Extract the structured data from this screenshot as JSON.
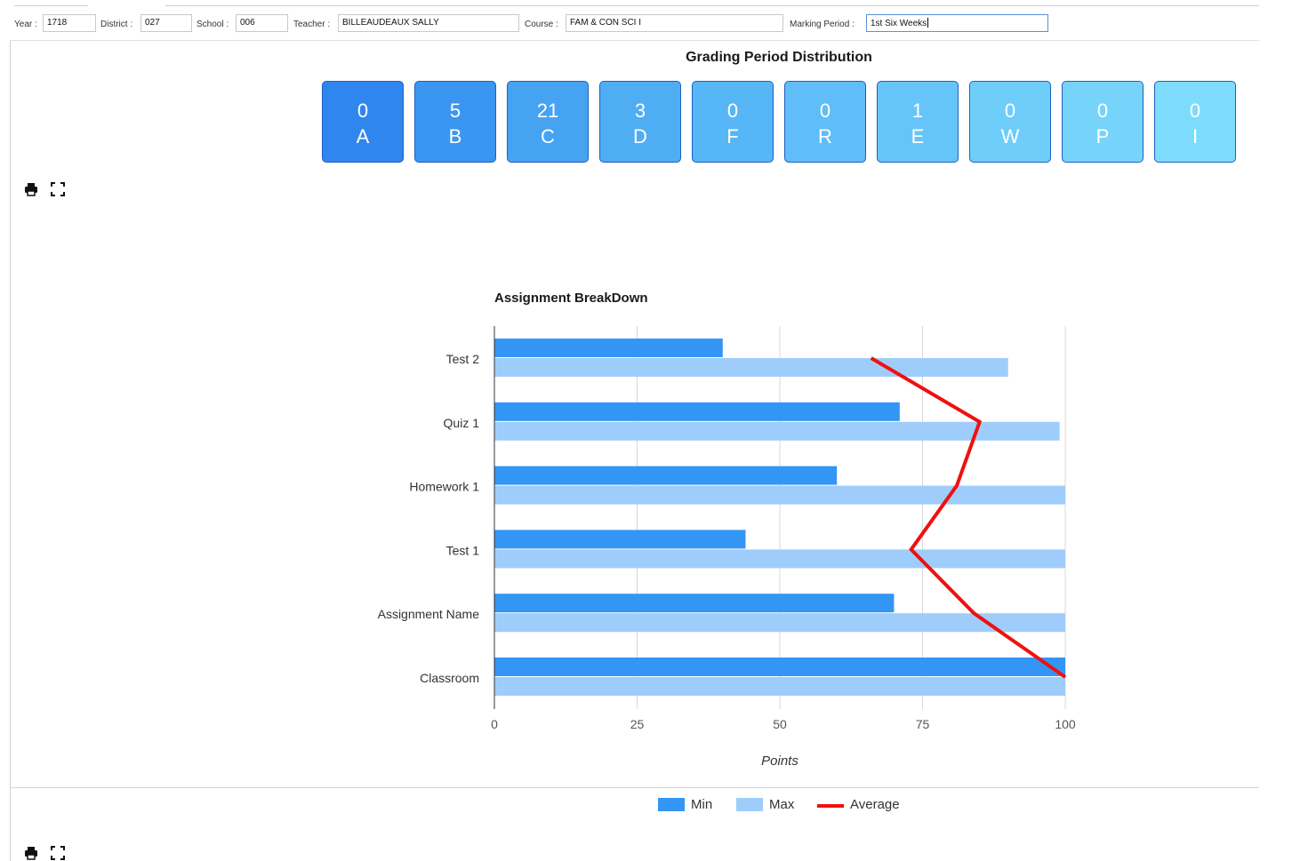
{
  "filters": {
    "year_label": "Year :",
    "year_value": "1718",
    "district_label": "District :",
    "district_value": "027",
    "school_label": "School :",
    "school_value": "006",
    "teacher_label": "Teacher :",
    "teacher_value": "BILLEAUDEAUX SALLY",
    "course_label": "Course :",
    "course_value": "FAM & CON SCI I",
    "marking_label": "Marking Period :",
    "marking_value": "1st Six Weeks"
  },
  "distribution": {
    "title": "Grading Period Distribution",
    "tiles": [
      {
        "count": "0",
        "grade": "A",
        "color": "#2f86ee"
      },
      {
        "count": "5",
        "grade": "B",
        "color": "#3a96f1"
      },
      {
        "count": "21",
        "grade": "C",
        "color": "#45a3f2"
      },
      {
        "count": "3",
        "grade": "D",
        "color": "#4fadf4"
      },
      {
        "count": "0",
        "grade": "F",
        "color": "#56b6f6"
      },
      {
        "count": "0",
        "grade": "R",
        "color": "#5fbdf7"
      },
      {
        "count": "1",
        "grade": "E",
        "color": "#66c5f8"
      },
      {
        "count": "0",
        "grade": "W",
        "color": "#6ecdf9"
      },
      {
        "count": "0",
        "grade": "P",
        "color": "#76d4fb"
      },
      {
        "count": "0",
        "grade": "I",
        "color": "#7ddcfc"
      }
    ]
  },
  "icons": {
    "print": "print-icon",
    "fullscreen": "expand-icon"
  },
  "chart_data": {
    "type": "bar",
    "orientation": "horizontal",
    "title": "Assignment BreakDown",
    "xlabel": "Points",
    "ylabel": "",
    "xlim": [
      0,
      100
    ],
    "xticks": [
      0,
      25,
      50,
      75,
      100
    ],
    "grid": true,
    "legend_position": "bottom",
    "categories": [
      "Test 2",
      "Quiz 1",
      "Homework 1",
      "Test 1",
      "Assignment Name",
      "Classroom"
    ],
    "series": [
      {
        "name": "Min",
        "kind": "bar",
        "color": "#3396f5",
        "values": [
          40,
          71,
          60,
          44,
          70,
          100
        ]
      },
      {
        "name": "Max",
        "kind": "bar",
        "color": "#9fcdfb",
        "values": [
          90,
          99,
          100,
          100,
          100,
          100
        ]
      },
      {
        "name": "Average",
        "kind": "line",
        "color": "#f01010",
        "values": [
          66,
          85,
          81,
          73,
          84,
          100
        ]
      }
    ]
  }
}
